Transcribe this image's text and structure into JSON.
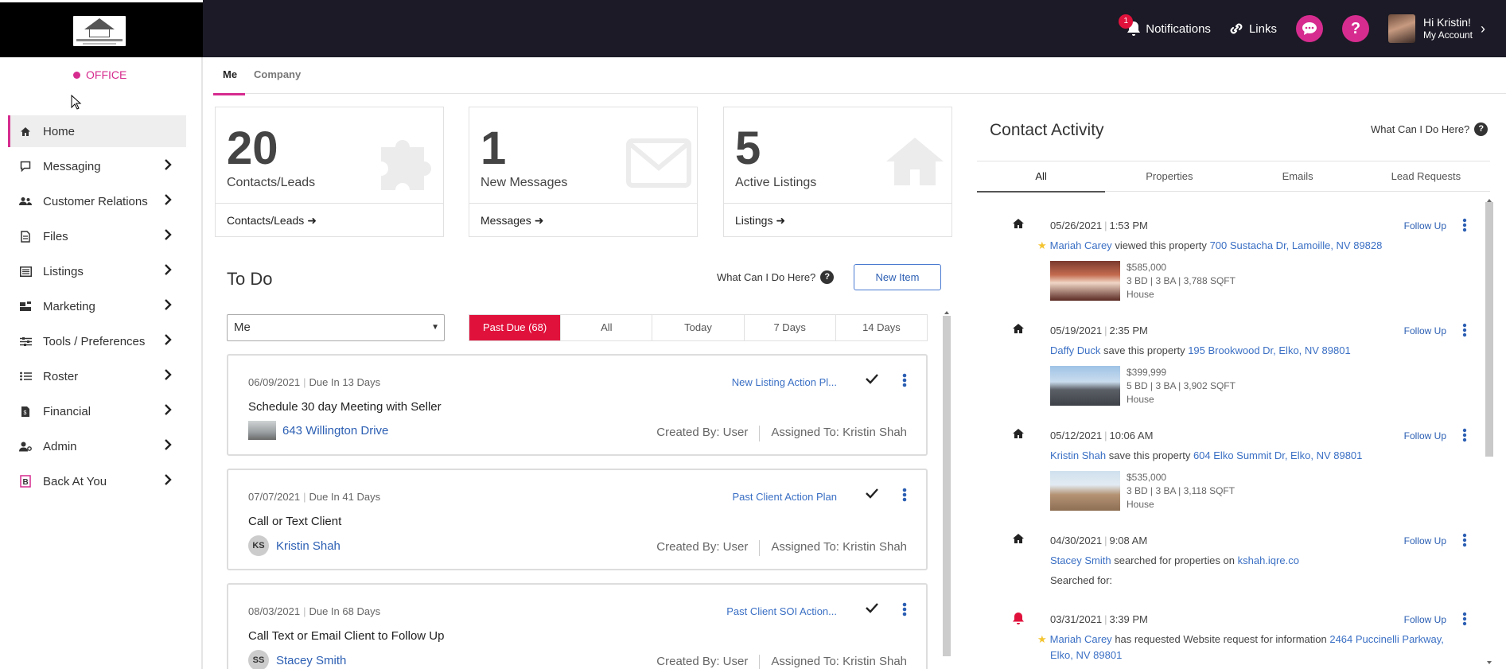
{
  "topbar": {
    "notifications_label": "Notifications",
    "notifications_count": "1",
    "links_label": "Links",
    "help_symbol": "?",
    "greeting": "Hi Kristin!",
    "account_label": "My Account",
    "icons": [
      "bell-icon",
      "link-icon",
      "chat-icon",
      "help-icon",
      "chevron-right-icon"
    ]
  },
  "sidebar": {
    "office_label": "OFFICE",
    "items": [
      {
        "label": "Home",
        "icon": "home-icon"
      },
      {
        "label": "Messaging",
        "icon": "chat-icon"
      },
      {
        "label": "Customer Relations",
        "icon": "users-icon"
      },
      {
        "label": "Files",
        "icon": "file-icon"
      },
      {
        "label": "Listings",
        "icon": "list-icon"
      },
      {
        "label": "Marketing",
        "icon": "marketing-icon"
      },
      {
        "label": "Tools / Preferences",
        "icon": "sliders-icon"
      },
      {
        "label": "Roster",
        "icon": "roster-icon"
      },
      {
        "label": "Financial",
        "icon": "financial-icon"
      },
      {
        "label": "Admin",
        "icon": "admin-icon"
      },
      {
        "label": "Back At You",
        "icon": "bay-icon"
      }
    ]
  },
  "tabs": {
    "me": "Me",
    "company": "Company"
  },
  "stats": [
    {
      "number": "20",
      "label": "Contacts/Leads",
      "link": "Contacts/Leads",
      "icon": "puzzle-icon"
    },
    {
      "number": "1",
      "label": "New Messages",
      "link": "Messages",
      "icon": "envelope-icon"
    },
    {
      "number": "5",
      "label": "Active Listings",
      "link": "Listings",
      "icon": "house-icon"
    }
  ],
  "todo": {
    "title": "To Do",
    "help_label": "What Can I Do Here?",
    "new_item_label": "New Item",
    "assignee_select": "Me",
    "filters": [
      "Past Due (68)",
      "All",
      "Today",
      "7 Days",
      "14 Days"
    ],
    "tasks": [
      {
        "date": "06/09/2021",
        "due": "Due In 13 Days",
        "plan": "New Listing Action Pl...",
        "title": "Schedule 30 day Meeting with Seller",
        "name": "643 Willington Drive",
        "initials": "",
        "created": "Created By: User",
        "assigned": "Assigned To: Kristin Shah"
      },
      {
        "date": "07/07/2021",
        "due": "Due In 41 Days",
        "plan": "Past Client Action Plan",
        "title": "Call or Text Client",
        "name": "Kristin Shah",
        "initials": "KS",
        "created": "Created By: User",
        "assigned": "Assigned To: Kristin Shah"
      },
      {
        "date": "08/03/2021",
        "due": "Due In 68 Days",
        "plan": "Past Client SOI Action...",
        "title": "Call Text or Email Client to Follow Up",
        "name": "Stacey Smith",
        "initials": "SS",
        "created": "Created By: User",
        "assigned": "Assigned To: Kristin Shah"
      }
    ]
  },
  "contact_activity": {
    "title": "Contact Activity",
    "help_label": "What Can I Do Here?",
    "tabs": [
      "All",
      "Properties",
      "Emails",
      "Lead Requests"
    ],
    "follow_up_label": "Follow Up",
    "items": [
      {
        "date": "05/26/2021",
        "time": "1:53 PM",
        "contact": "Mariah Carey",
        "action": "viewed this property",
        "target": "700 Sustacha Dr, Lamoille, NV 89828",
        "price": "$585,000",
        "specs": "3 BD | 3 BA | 3,788 SQFT",
        "type": "House"
      },
      {
        "date": "05/19/2021",
        "time": "2:35 PM",
        "contact": "Daffy Duck",
        "action": "save this property",
        "target": "195 Brookwood Dr, Elko, NV 89801",
        "price": "$399,999",
        "specs": "5 BD | 3 BA | 3,902 SQFT",
        "type": "House"
      },
      {
        "date": "05/12/2021",
        "time": "10:06 AM",
        "contact": "Kristin Shah",
        "action": "save this property",
        "target": "604 Elko Summit Dr, Elko, NV 89801",
        "price": "$535,000",
        "specs": "3 BD | 3 BA | 3,118 SQFT",
        "type": "House"
      },
      {
        "date": "04/30/2021",
        "time": "9:08 AM",
        "contact": "Stacey Smith",
        "action": "searched for properties on",
        "target": "kshah.iqre.co",
        "searched_for": "Searched for:"
      },
      {
        "date": "03/31/2021",
        "time": "3:39 PM",
        "contact": "Mariah Carey",
        "action": "has requested Website request for information",
        "target": "2464 Puccinelli Parkway,",
        "target2": "Elko, NV 89801"
      }
    ]
  },
  "colors": {
    "accent": "#d62c8f",
    "danger": "#e0123c",
    "link": "#2c5fb3",
    "topbar": "#1b1a26"
  }
}
